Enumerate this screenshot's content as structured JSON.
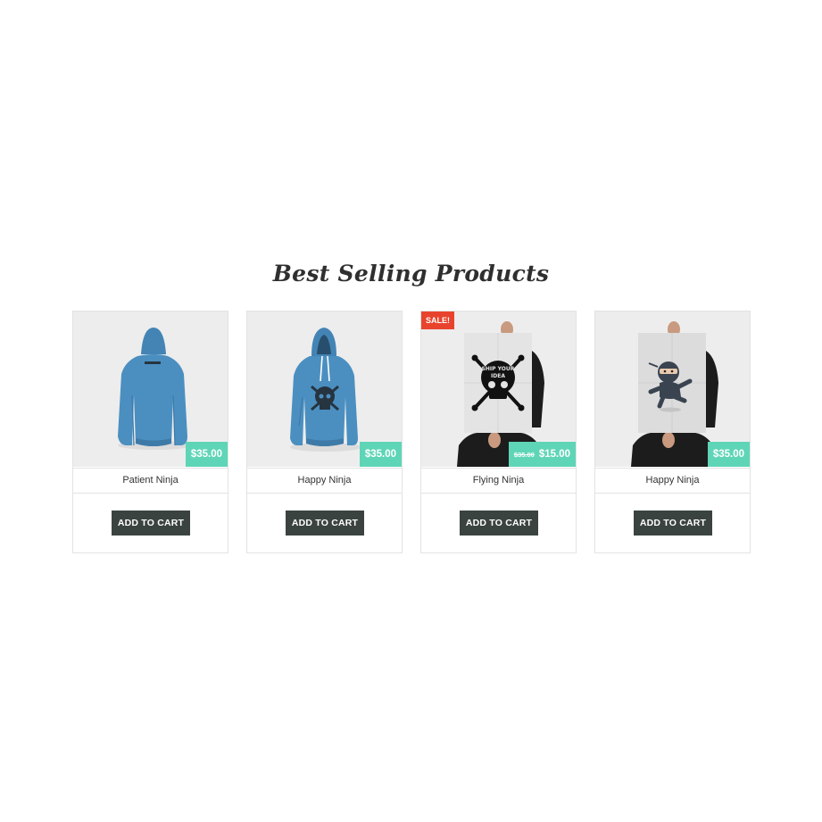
{
  "section": {
    "title": "Best Selling Products"
  },
  "products": [
    {
      "name": "Patient Ninja",
      "price": "$35.00",
      "button": "ADD TO CART",
      "image": "blue-hoodie-back"
    },
    {
      "name": "Happy Ninja",
      "price": "$35.00",
      "button": "ADD TO CART",
      "image": "blue-hoodie-front-skull"
    },
    {
      "name": "Flying Ninja",
      "price": "$15.00",
      "old_price": "$35.00",
      "sale_badge": "SALE!",
      "button": "ADD TO CART",
      "image": "ship-your-idea-poster",
      "poster_text": [
        "SHIP YOUR",
        "IDEA"
      ]
    },
    {
      "name": "Happy Ninja",
      "price": "$35.00",
      "button": "ADD TO CART",
      "image": "ninja-poster"
    }
  ],
  "colors": {
    "price_tag": "#5fd5b7",
    "button": "#3b4340",
    "sale": "#e8442d",
    "hoodie": "#4b8fc0"
  }
}
